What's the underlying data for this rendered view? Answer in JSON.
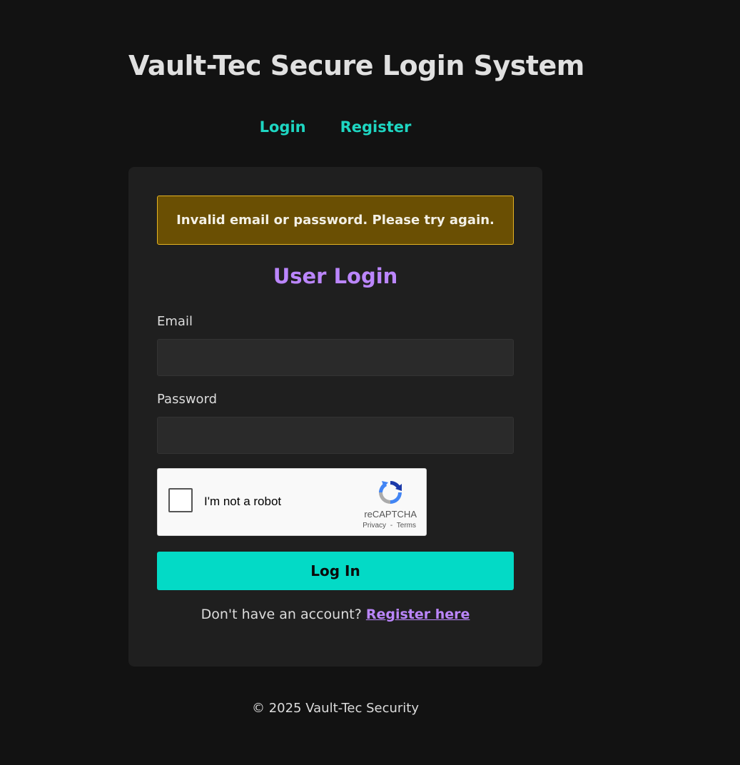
{
  "header": {
    "title": "Vault-Tec Secure Login System",
    "nav": [
      {
        "label": "Login"
      },
      {
        "label": "Register"
      }
    ]
  },
  "alert": {
    "message": "Invalid email or password. Please try again."
  },
  "form": {
    "heading": "User Login",
    "email_label": "Email",
    "email_value": "",
    "password_label": "Password",
    "password_value": "",
    "submit_label": "Log In",
    "register_prompt": "Don't have an account?",
    "register_link": "Register here"
  },
  "recaptcha": {
    "label": "I'm not a robot",
    "brand": "reCAPTCHA",
    "privacy": "Privacy",
    "separator": "-",
    "terms": "Terms",
    "checked": false
  },
  "footer": {
    "text": "© 2025 Vault-Tec Security"
  },
  "colors": {
    "background": "#121212",
    "card": "#1f1f1f",
    "accent_teal": "#03dac6",
    "accent_purple": "#bb86fc",
    "alert_bg": "#6a4f03",
    "alert_border": "#e6b422"
  },
  "icons": {
    "recaptcha_logo": "recaptcha-logo-icon"
  }
}
